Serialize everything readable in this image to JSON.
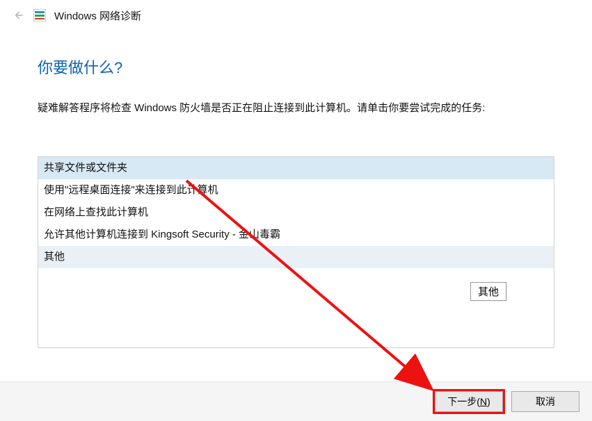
{
  "header": {
    "title": "Windows 网络诊断"
  },
  "content": {
    "heading": "你要做什么?",
    "description": "疑难解答程序将检查 Windows 防火墙是否正在阻止连接到此计算机。请单击你要尝试完成的任务:",
    "options": [
      "共享文件或文件夹",
      "使用\"远程桌面连接\"来连接到此计算机",
      "在网络上查找此计算机",
      "允许其他计算机连接到 Kingsoft Security - 金山毒霸",
      "其他"
    ],
    "tooltip": "其他"
  },
  "footer": {
    "next_prefix": "下一步(",
    "next_key": "N",
    "next_suffix": ")",
    "cancel": "取消"
  }
}
